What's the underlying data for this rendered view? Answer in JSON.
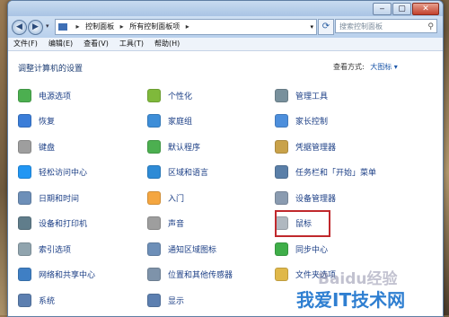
{
  "window": {
    "caption": {
      "minimize": "‒",
      "maximize": "▢",
      "close": "✕"
    }
  },
  "nav": {
    "back": "◀",
    "forward": "▶"
  },
  "address": {
    "crumb1": "控制面板",
    "crumb2": "所有控制面板项"
  },
  "search": {
    "placeholder": "搜索控制面板"
  },
  "menu": {
    "file": "文件(F)",
    "edit": "编辑(E)",
    "view": "查看(V)",
    "tools": "工具(T)",
    "help": "帮助(H)"
  },
  "content": {
    "heading": "调整计算机的设置",
    "view_by_label": "查看方式:",
    "view_by_value": "大图标 ▾"
  },
  "items": {
    "col1": [
      "电源选项",
      "恢复",
      "键盘",
      "轻松访问中心",
      "日期和时间",
      "设备和打印机",
      "索引选项",
      "网络和共享中心",
      "系统"
    ],
    "col2": [
      "个性化",
      "家庭组",
      "默认程序",
      "区域和语言",
      "入门",
      "声音",
      "通知区域图标",
      "位置和其他传感器",
      "显示"
    ],
    "col3": [
      "管理工具",
      "家长控制",
      "凭据管理器",
      "任务栏和「开始」菜单",
      "设备管理器",
      "鼠标",
      "同步中心",
      "文件夹选项"
    ]
  },
  "icons": {
    "col1": [
      "power-options-icon",
      "recovery-icon",
      "keyboard-icon",
      "ease-of-access-icon",
      "date-time-icon",
      "devices-printers-icon",
      "indexing-icon",
      "network-sharing-icon",
      "system-icon"
    ],
    "col2": [
      "personalization-icon",
      "homegroup-icon",
      "default-programs-icon",
      "region-language-icon",
      "getting-started-icon",
      "sound-icon",
      "notification-icons-icon",
      "location-sensors-icon",
      "display-icon"
    ],
    "col3": [
      "admin-tools-icon",
      "parental-controls-icon",
      "credential-manager-icon",
      "taskbar-start-icon",
      "device-manager-icon",
      "mouse-icon",
      "sync-center-icon",
      "folder-options-icon"
    ]
  },
  "colors": {
    "link": "#1c3f86",
    "highlight": "#c0282c",
    "icons": {
      "col1": [
        "#4caf50",
        "#3b7dd8",
        "#9e9e9e",
        "#2196f3",
        "#6d8fb8",
        "#607d8b",
        "#90a4ae",
        "#3f7fc4",
        "#5c7fb0"
      ],
      "col2": [
        "#7fb93b",
        "#3e8ed8",
        "#4caf50",
        "#2e8bd6",
        "#f4a640",
        "#9e9e9e",
        "#6d8fb8",
        "#7e93aa",
        "#5c7fb0"
      ],
      "col3": [
        "#78909c",
        "#4d8fdc",
        "#c9a24a",
        "#5a7fa8",
        "#8a9bb0",
        "#b0b8c0",
        "#3fae49",
        "#e0b84a"
      ]
    }
  },
  "watermark": "Baidu经验",
  "logo": "我爱IT技术网"
}
